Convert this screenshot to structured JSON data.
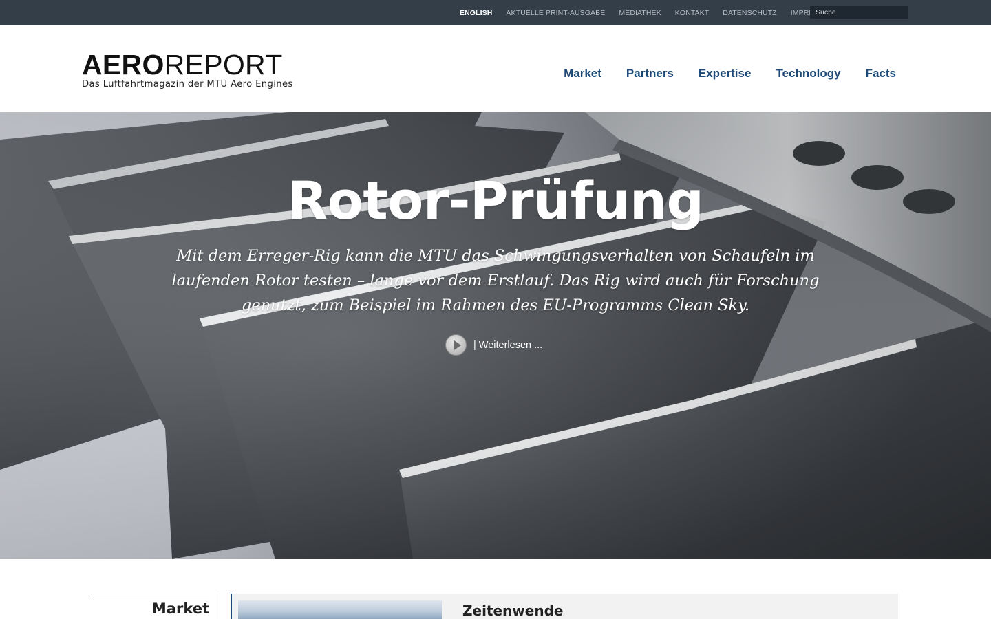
{
  "topbar": {
    "links": [
      {
        "label": "ENGLISH",
        "active": true
      },
      {
        "label": "AKTUELLE PRINT-AUSGABE",
        "active": false
      },
      {
        "label": "MEDIATHEK",
        "active": false
      },
      {
        "label": "KONTAKT",
        "active": false
      },
      {
        "label": "DATENSCHUTZ",
        "active": false
      },
      {
        "label": "IMPRESSUM",
        "active": false
      }
    ],
    "search_placeholder": "Suche"
  },
  "header": {
    "logo_bold": "AERO",
    "logo_light": "REPORT",
    "logo_subtitle": "Das Luftfahrtmagazin der MTU Aero Engines",
    "nav": [
      "Market",
      "Partners",
      "Expertise",
      "Technology",
      "Facts"
    ]
  },
  "hero": {
    "title": "Rotor-Prüfung",
    "text": "Mit dem Erreger-Rig kann die MTU das Schwingungsverhalten von Schaufeln im laufenden Rotor testen – lange vor dem Erstlauf. Das Rig wird auch für Forschung genutzt, zum Beispiel im Rahmen des EU-Programms Clean Sky.",
    "readmore": "| Weiterlesen ..."
  },
  "section": {
    "label": "Market",
    "card_title": "Zeitenwende"
  },
  "colors": {
    "topbar": "#333e48",
    "nav": "#1e4a78",
    "accent": "#1e4a78"
  }
}
